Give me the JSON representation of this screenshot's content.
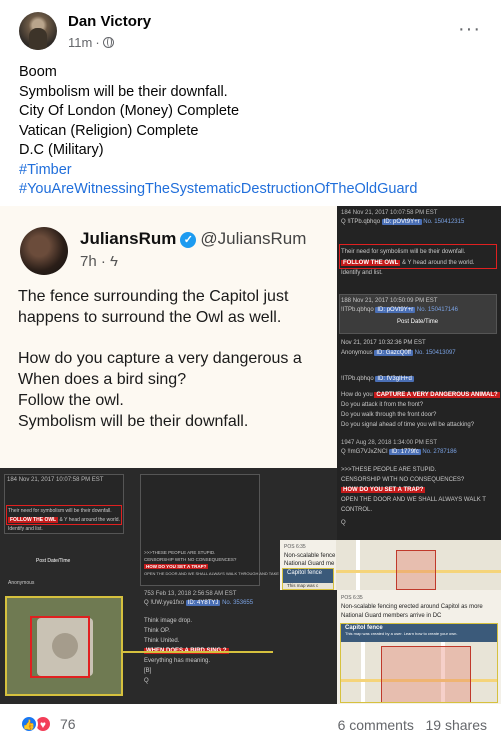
{
  "post": {
    "author": "Dan Victory",
    "time": "11m",
    "separator": "·",
    "more": "···",
    "lines": [
      "Boom",
      "Symbolism will be their downfall.",
      "City Of London (Money)  Complete",
      "Vatican (Religion) Complete",
      "D.C (Military)"
    ],
    "hashtags": [
      "#Timber",
      "#YouAreWitnessingTheSystematicDestructionOfTheOldGuard"
    ]
  },
  "tweet": {
    "name": "JuliansRum",
    "handle": "@JuliansRum",
    "time": "7h",
    "p1_l1": "The fence surrounding the Capitol just",
    "p1_l2": "happens to surround the Owl as well.",
    "p2_l1": "How do you capture a very dangerous a",
    "p2_l2": "When does a bird sing?",
    "p2_l3": "Follow the owl.",
    "p2_l4": "Symbolism will be their downfall."
  },
  "drops": {
    "top": {
      "num": "184",
      "date": "Nov 21, 2017 10:07:58 PM EST",
      "q": "Q",
      "trip": "!ITPb.qbhqo",
      "id": "ID: pOVt9Y+r",
      "no": "No. 150412315",
      "l1": "Their need for symbolism will be their downfall.",
      "follow": "FOLLOW THE OWL",
      "l2": "& Y head around the world.",
      "l3": "Identify and list.",
      "n2": "188",
      "date2": "Nov 21, 2017 10:50:09 PM EST",
      "trip2": "!ITPb.qbhqo",
      "id2": "ID: pOVt9Y+r",
      "no2": "No. 150417146",
      "post_dt": "Post Date/Time",
      "date3": "Nov 21, 2017 10:32:36 PM EST",
      "anon": "Anonymous",
      "id3": "ID: GazcQ0ff",
      "no3": "No. 150413097"
    },
    "mid": {
      "trip": "!ITPb.qbhqo",
      "id": "ID: fV3gIH+d",
      "q1": "How do you",
      "q1r": "CAPTURE A VERY DANGEROUS ANIMAL?",
      "q2": "Do you attack it from the front?",
      "q3": "Do you walk through the front door?",
      "q4": "Do you signal ahead of time you will be attacking?",
      "num": "1947",
      "date": "Aug 28, 2018 1:34:00 PM EST",
      "q": "Q",
      "trip2": "!!mG7VJxZNCI",
      "id2": "ID: 1779fc",
      "no2": "No. 2787186",
      "a1": ">>>THESE PEOPLE ARE STUPID.",
      "a2": "CENSORSHIP WITH NO CONSEQUENCES?",
      "trap": "HOW DO YOU SET A TRAP?",
      "a3": "OPEN THE DOOR AND WE SHALL ALWAYS WALK T",
      "a4": "CONTROL.",
      "a5": "Q"
    },
    "left": {
      "num": "184",
      "date": "Nov 21, 2017 10:07:58 PM EST",
      "l1": "Their need for symbolism will be their downfall.",
      "follow": "FOLLOW THE OWL",
      "l2": "& Y head around the world.",
      "l3": "Identify and list.",
      "post_dt": "Post Date/Time",
      "anon": "Anonymous",
      "mid_a1": ">>>THESE PEOPLE ARE STUPID.",
      "mid_a2": "CENSORSHIP WITH NO CONSEQUENCES?",
      "mid_trap": "HOW DO YOU SET A TRAP?",
      "mid_a3": "OPEN THE DOOR AND WE SHALL ALWAYS WALK THROUGH AND TAKE CONTROL.",
      "num2": "753",
      "date2": "Feb 13, 2018 2:56:58 AM EST",
      "q": "Q",
      "trip2": "!UW.yye1fxo",
      "id2": "ID: 4Y8TYJ",
      "no2": "No. 353655",
      "t1": "Think image drop.",
      "t2": "Think OP.",
      "t3": "Think United.",
      "bird": "WHEN DOES A BIRD SING ?",
      "t4": "Everything has meaning.",
      "t5": "[B]",
      "t6": "Q"
    },
    "br1": {
      "pos": "POS 6:35",
      "t1": "Non-scalable fence",
      "t2": "National Guard me",
      "fence": "Capitol fence",
      "map_note": "This map was c"
    },
    "br2": {
      "pos": "POS 6:35",
      "t1": "Non-scalable fencing erected around Capitol as more",
      "t2": "National Guard members arrive in DC",
      "fence": "Capitol fence",
      "map_note": "This map was created by a user. Learn how to create your own."
    }
  },
  "footer": {
    "like_icon": "👍",
    "love_icon": "♥",
    "reaction_count": "76",
    "comments": "6 comments",
    "shares": "19 shares"
  }
}
